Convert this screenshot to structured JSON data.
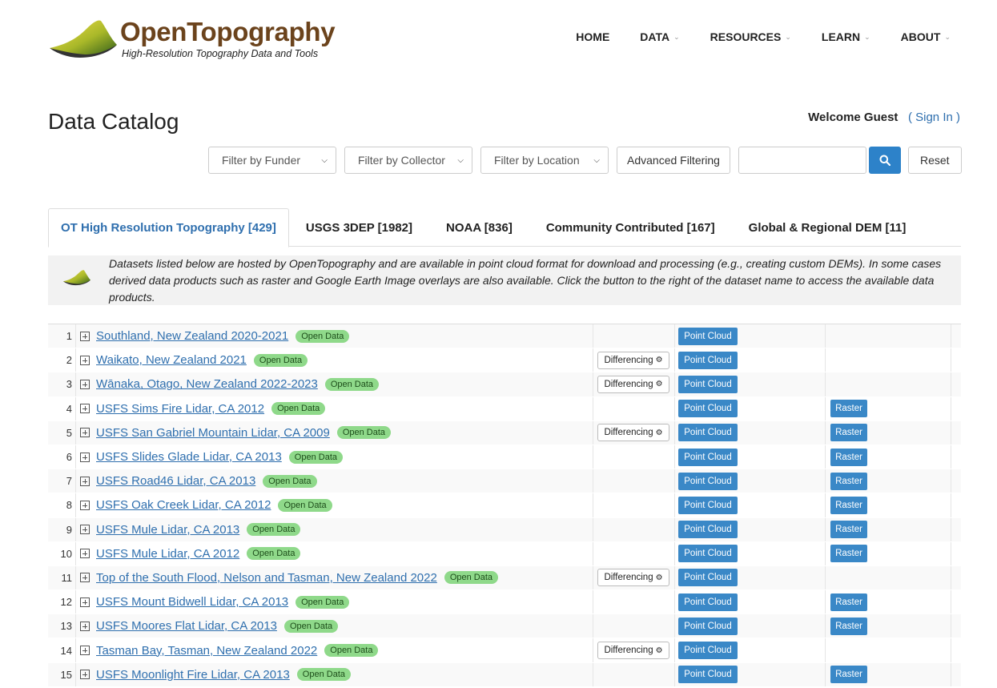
{
  "brand": {
    "title": "OpenTopography",
    "subtitle": "High-Resolution Topography Data and Tools"
  },
  "nav": [
    {
      "label": "HOME",
      "dropdown": false
    },
    {
      "label": "DATA",
      "dropdown": true
    },
    {
      "label": "RESOURCES",
      "dropdown": true
    },
    {
      "label": "LEARN",
      "dropdown": true
    },
    {
      "label": "ABOUT",
      "dropdown": true
    }
  ],
  "page_title": "Data Catalog",
  "welcome": {
    "text": "Welcome Guest",
    "open": "(",
    "link": "Sign In",
    "close": ")"
  },
  "filters": {
    "funder": "Filter by Funder",
    "collector": "Filter by Collector",
    "location": "Filter by Location",
    "advanced": "Advanced Filtering",
    "search_value": "",
    "reset": "Reset"
  },
  "tabs": [
    {
      "label": "OT High Resolution Topography [429]",
      "active": true
    },
    {
      "label": "USGS 3DEP [1982]",
      "active": false
    },
    {
      "label": "NOAA [836]",
      "active": false
    },
    {
      "label": "Community Contributed [167]",
      "active": false
    },
    {
      "label": "Global & Regional DEM [11]",
      "active": false
    }
  ],
  "info_text": "Datasets listed below are hosted by OpenTopography and are available in point cloud format for download and processing (e.g., creating custom DEMs). In some cases derived data products such as raster and Google Earth Image overlays are also available. Click the button to the right of the dataset name to access the available data products.",
  "labels": {
    "open_data": "Open Data",
    "differencing": "Differencing",
    "point_cloud": "Point Cloud",
    "raster": "Raster"
  },
  "datasets": [
    {
      "num": "1",
      "name": "Southland, New Zealand 2020-2021",
      "differencing": false,
      "point_cloud": true,
      "raster": false
    },
    {
      "num": "2",
      "name": "Waikato, New Zealand 2021",
      "differencing": true,
      "point_cloud": true,
      "raster": false
    },
    {
      "num": "3",
      "name": "Wānaka, Otago, New Zealand 2022-2023",
      "differencing": true,
      "point_cloud": true,
      "raster": false
    },
    {
      "num": "4",
      "name": "USFS Sims Fire Lidar, CA 2012",
      "differencing": false,
      "point_cloud": true,
      "raster": true
    },
    {
      "num": "5",
      "name": "USFS San Gabriel Mountain Lidar, CA 2009",
      "differencing": true,
      "point_cloud": true,
      "raster": true
    },
    {
      "num": "6",
      "name": "USFS Slides Glade Lidar, CA 2013",
      "differencing": false,
      "point_cloud": true,
      "raster": true
    },
    {
      "num": "7",
      "name": "USFS Road46 Lidar, CA 2013",
      "differencing": false,
      "point_cloud": true,
      "raster": true
    },
    {
      "num": "8",
      "name": "USFS Oak Creek Lidar, CA 2012",
      "differencing": false,
      "point_cloud": true,
      "raster": true
    },
    {
      "num": "9",
      "name": "USFS Mule Lidar, CA 2013",
      "differencing": false,
      "point_cloud": true,
      "raster": true
    },
    {
      "num": "10",
      "name": "USFS Mule Lidar, CA 2012",
      "differencing": false,
      "point_cloud": true,
      "raster": true
    },
    {
      "num": "11",
      "name": "Top of the South Flood, Nelson and Tasman, New Zealand 2022",
      "differencing": true,
      "point_cloud": true,
      "raster": false
    },
    {
      "num": "12",
      "name": "USFS Mount Bidwell Lidar, CA 2013",
      "differencing": false,
      "point_cloud": true,
      "raster": true
    },
    {
      "num": "13",
      "name": "USFS Moores Flat Lidar, CA 2013",
      "differencing": false,
      "point_cloud": true,
      "raster": true
    },
    {
      "num": "14",
      "name": "Tasman Bay, Tasman, New Zealand 2022",
      "differencing": true,
      "point_cloud": true,
      "raster": false
    },
    {
      "num": "15",
      "name": "USFS Moonlight Fire Lidar, CA 2013",
      "differencing": false,
      "point_cloud": true,
      "raster": true
    }
  ],
  "colors": {
    "brand_brown": "#6b431c",
    "link_blue": "#2f6fae",
    "button_blue": "#3a88c7",
    "badge_green": "#8fd98a"
  }
}
